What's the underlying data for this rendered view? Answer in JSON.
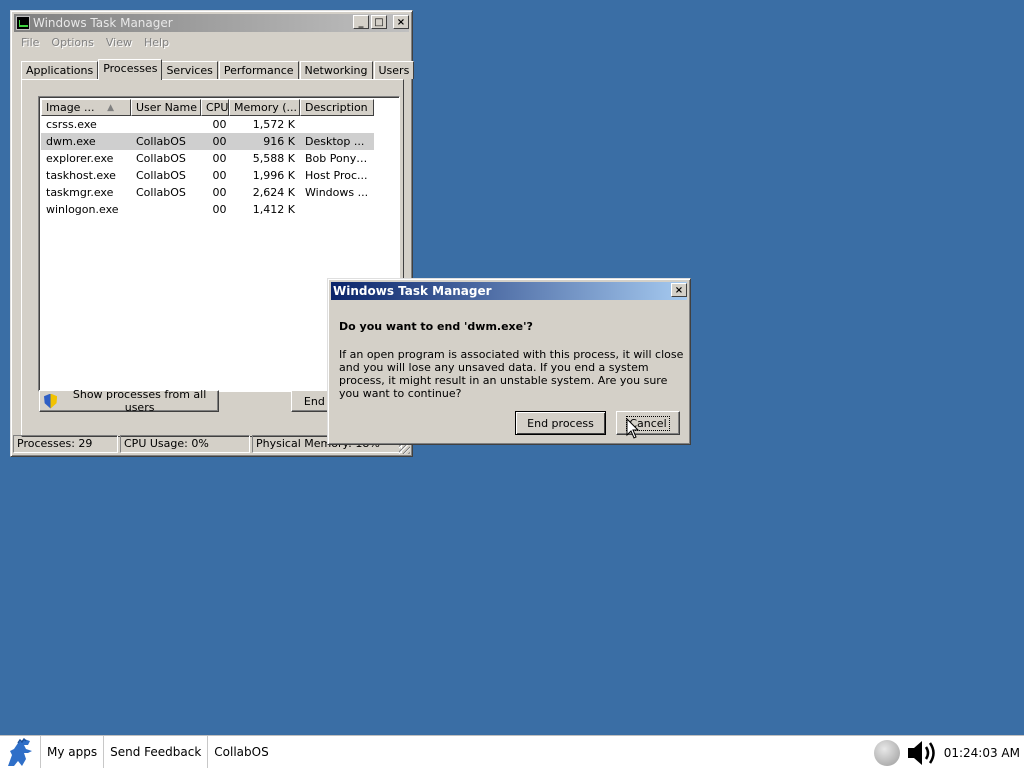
{
  "task_manager": {
    "title": "Windows Task Manager",
    "window_buttons": {
      "minimize": "_",
      "maximize": "□",
      "close": "×"
    },
    "menu": [
      "File",
      "Options",
      "View",
      "Help"
    ],
    "tabs": [
      "Applications",
      "Processes",
      "Services",
      "Performance",
      "Networking",
      "Users"
    ],
    "selected_tab": "Processes",
    "columns": [
      "Image ...",
      "User Name",
      "CPU",
      "Memory (...",
      "Description"
    ],
    "sort_indicator": "▲",
    "rows": [
      {
        "image": "csrss.exe",
        "user": "",
        "cpu": "00",
        "memory": "1,572 K",
        "desc": ""
      },
      {
        "image": "dwm.exe",
        "user": "CollabOS",
        "cpu": "00",
        "memory": "916 K",
        "desc": "Desktop ..."
      },
      {
        "image": "explorer.exe",
        "user": "CollabOS",
        "cpu": "00",
        "memory": "5,588 K",
        "desc": "Bob Pony ..."
      },
      {
        "image": "taskhost.exe",
        "user": "CollabOS",
        "cpu": "00",
        "memory": "1,996 K",
        "desc": "Host Proc..."
      },
      {
        "image": "taskmgr.exe",
        "user": "CollabOS",
        "cpu": "00",
        "memory": "2,624 K",
        "desc": "Windows ..."
      },
      {
        "image": "winlogon.exe",
        "user": "",
        "cpu": "00",
        "memory": "1,412 K",
        "desc": ""
      }
    ],
    "selected_row": 1,
    "show_all_label": "Show processes from all users",
    "end_process_label": "End Process",
    "status": {
      "processes": "Processes: 29",
      "cpu": "CPU Usage: 0%",
      "memory": "Physical Memory: 18%"
    }
  },
  "dialog": {
    "title": "Windows Task Manager",
    "close": "×",
    "heading": "Do you want to end 'dwm.exe'?",
    "body": "If an open program is associated with this process, it will close and you will lose any unsaved data. If you end a system process, it might result in an unstable system. Are you sure you want to continue?",
    "end_label": "End process",
    "cancel_label": "Cancel"
  },
  "taskbar": {
    "items": [
      "My apps",
      "Send Feedback",
      "CollabOS"
    ],
    "clock": "01:24:03 AM"
  },
  "colors": {
    "desktop": "#3a6ea5",
    "active_title_start": "#0a246a",
    "active_title_end": "#a6caf0",
    "face": "#d4d0c8"
  }
}
